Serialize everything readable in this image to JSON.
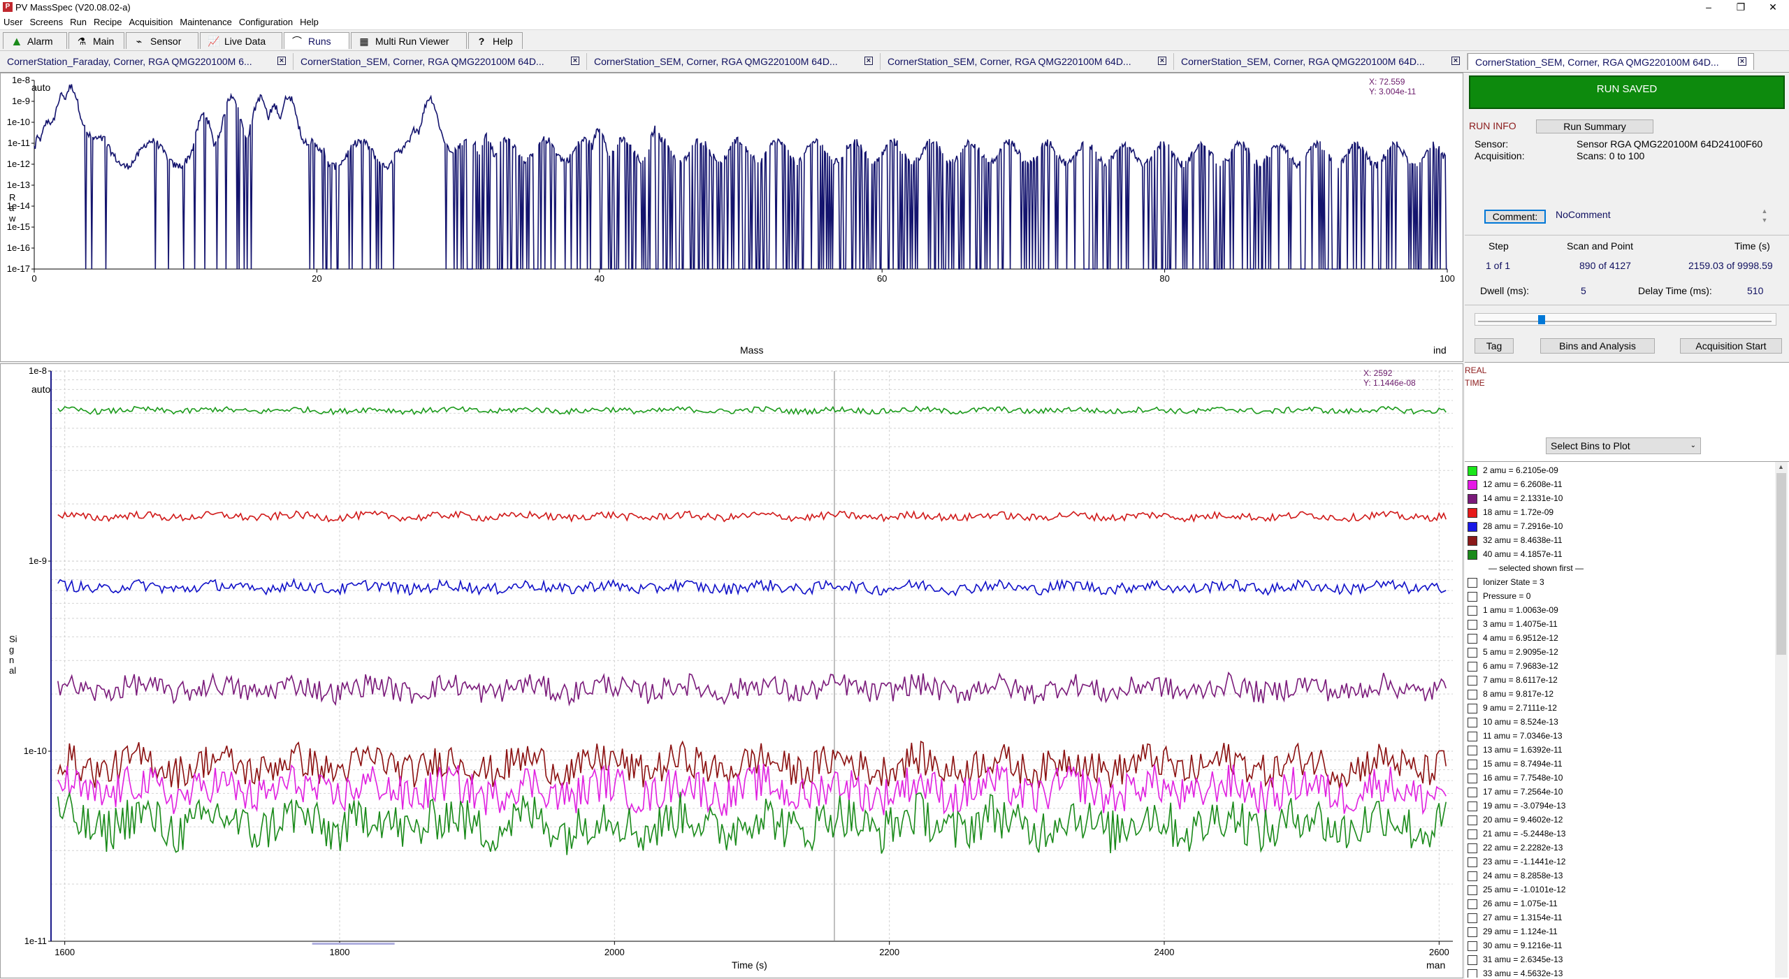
{
  "window": {
    "title": "PV MassSpec  (V20.08.02-a)",
    "controls": [
      "–",
      "❐",
      "✕"
    ]
  },
  "menu": [
    "User",
    "Screens",
    "Run",
    "Recipe",
    "Acquisition",
    "Maintenance",
    "Configuration",
    "Help"
  ],
  "toolbar": [
    {
      "label": "Alarm",
      "icon": "warning-triangle-icon"
    },
    {
      "label": "Main",
      "icon": "flask-icon"
    },
    {
      "label": "Sensor",
      "icon": "sensor-icon"
    },
    {
      "label": "Live Data",
      "icon": "chart-icon"
    },
    {
      "label": "Runs",
      "icon": "runs-icon"
    },
    {
      "label": "Multi Run Viewer",
      "icon": "multi-run-icon"
    },
    {
      "label": "Help",
      "icon": "question-icon"
    }
  ],
  "run_tabs": [
    "CornerStation_Faraday, Corner, RGA QMG220100M 6...",
    "CornerStation_SEM, Corner, RGA QMG220100M 64D...",
    "CornerStation_SEM, Corner, RGA QMG220100M 64D...",
    "CornerStation_SEM, Corner, RGA QMG220100M 64D...",
    "CornerStation_SEM, Corner, RGA QMG220100M 64D...",
    "CornerStation_SEM, Corner, RGA QMG220100M 64D..."
  ],
  "colors": {
    "trace_navy": "#14146e",
    "run_saved_green": "#0d8a0d",
    "label_red": "#8b1a1a",
    "cursor_text": "#6a1a6a"
  },
  "top_plot": {
    "scale_label": "auto",
    "cursor_x": "X: 72.559",
    "cursor_y": "Y: 3.004e-11",
    "ylabel": "Raw",
    "xlabel": "Mass",
    "x_unit": "ind",
    "y_ticks": [
      "1e-8",
      "1e-9",
      "1e-10",
      "1e-11",
      "1e-12",
      "1e-13",
      "1e-14",
      "1e-15",
      "1e-16",
      "1e-17"
    ],
    "x_ticks": [
      "0",
      "20",
      "40",
      "60",
      "80",
      "100"
    ]
  },
  "bottom_plot": {
    "scale_label": "auto",
    "cursor_x": "X: 2592",
    "cursor_y": "Y: 1.1446e-08",
    "ylabel": "Signal",
    "xlabel": "Time (s)",
    "x_unit": "man",
    "y_ticks": [
      "1e-8",
      "1e-9",
      "1e-10",
      "1e-11"
    ],
    "x_ticks": [
      "1600",
      "1800",
      "2000",
      "2200",
      "2400",
      "2600"
    ]
  },
  "chart_data": [
    {
      "type": "line",
      "xlabel": "Mass",
      "ylabel": "Raw",
      "xlim": [
        0,
        100
      ],
      "ylim": [
        1e-17,
        1e-08
      ],
      "yscale": "log",
      "cursor": {
        "x": 72.559,
        "y": 3.004e-11
      },
      "series": [
        {
          "peaks": [
            {
              "x": 1,
              "y": 1.2e-10
            },
            {
              "x": 2,
              "y": 2e-09
            },
            {
              "x": 2.6,
              "y": 5e-09
            },
            {
              "x": 12,
              "y": 2.5e-10
            },
            {
              "x": 14,
              "y": 2e-09
            },
            {
              "x": 16,
              "y": 1.5e-09
            },
            {
              "x": 17,
              "y": 6e-10
            },
            {
              "x": 18,
              "y": 1.8e-09
            },
            {
              "x": 27,
              "y": 5e-11
            },
            {
              "x": 28,
              "y": 1.5e-09
            },
            {
              "x": 32,
              "y": 2e-11
            },
            {
              "x": 40,
              "y": 5e-11
            },
            {
              "x": 44,
              "y": 5e-11
            }
          ]
        }
      ]
    },
    {
      "type": "line",
      "xlabel": "Time (s)",
      "ylabel": "Signal",
      "xlim": [
        1590,
        2610
      ],
      "ylim": [
        1e-11,
        1e-08
      ],
      "yscale": "log",
      "grid": true,
      "cursor": {
        "x": 2592,
        "y": 1.1446e-08,
        "line_x": 2160
      },
      "series": [
        {
          "name": "2 amu",
          "color": "#1a9a1a",
          "mean": 6.2105e-09
        },
        {
          "name": "18 amu",
          "color": "#d01818",
          "mean": 1.72e-09
        },
        {
          "name": "28 amu",
          "color": "#1010c8",
          "mean": 7.2916e-10
        },
        {
          "name": "14 amu",
          "color": "#7a1a7a",
          "mean": 2.1331e-10
        },
        {
          "name": "32 amu",
          "color": "#8b1010",
          "mean": 8.4638e-11
        },
        {
          "name": "12 amu",
          "color": "#e020e0",
          "mean": 6.2608e-11
        },
        {
          "name": "40 amu",
          "color": "#1a8a1a",
          "mean": 4.1857e-11
        }
      ]
    }
  ],
  "run_panel": {
    "status": "RUN  SAVED",
    "run_info_label": "RUN  INFO",
    "run_summary_button": "Run Summary",
    "sensor_label": "Sensor:",
    "sensor_value": "Sensor RGA QMG220100M 64D24100F60",
    "acquisition_label": "Acquisition:",
    "acquisition_value": "Scans: 0 to 100",
    "comment_button": "Comment:",
    "comment_value": "NoComment",
    "step_label": "Step",
    "step_value": "1 of 1",
    "scan_label": "Scan and Point",
    "scan_value": "890 of 4127",
    "time_label": "Time (s)",
    "time_value": "2159.03 of 9998.59",
    "dwell_label": "Dwell (ms):",
    "dwell_value": "5",
    "delay_label": "Delay Time (ms):",
    "delay_value": "510",
    "slider_fraction": 0.21,
    "tag_button": "Tag",
    "bins_button": "Bins and Analysis",
    "acq_start_button": "Acquisition Start",
    "realtime_label1": "REAL",
    "realtime_label2": "TIME",
    "select_bins": "Select Bins to Plot"
  },
  "legend_selected": [
    {
      "text": "2 amu = 6.2105e-09",
      "color": "#19e619"
    },
    {
      "text": "12 amu = 6.2608e-11",
      "color": "#e619e6"
    },
    {
      "text": "14 amu = 2.1331e-10",
      "color": "#7a1a7a"
    },
    {
      "text": "18 amu = 1.72e-09",
      "color": "#e61919"
    },
    {
      "text": "28 amu = 7.2916e-10",
      "color": "#1919e6"
    },
    {
      "text": "32 amu = 8.4638e-11",
      "color": "#8b1a1a"
    },
    {
      "text": "40 amu = 4.1857e-11",
      "color": "#1a8a1a"
    }
  ],
  "legend_separator": "— selected shown first —",
  "legend_unselected": [
    "Ionizer State = 3",
    "Pressure = 0",
    "1 amu = 1.0063e-09",
    "3 amu = 1.4075e-11",
    "4 amu = 6.9512e-12",
    "5 amu = 2.9095e-12",
    "6 amu = 7.9683e-12",
    "7 amu = 8.6117e-12",
    "8 amu = 9.817e-12",
    "9 amu = 2.7111e-12",
    "10 amu = 8.524e-13",
    "11 amu = 7.0346e-13",
    "13 amu = 1.6392e-11",
    "15 amu = 8.7494e-11",
    "16 amu = 7.7548e-10",
    "17 amu = 7.2564e-10",
    "19 amu = -3.0794e-13",
    "20 amu = 9.4602e-12",
    "21 amu = -5.2448e-13",
    "22 amu = 2.2282e-13",
    "23 amu = -1.1441e-12",
    "24 amu = 8.2858e-13",
    "25 amu = -1.0101e-12",
    "26 amu = 1.075e-11",
    "27 amu = 1.3154e-11",
    "29 amu = 1.124e-11",
    "30 amu = 9.1216e-11",
    "31 amu = 2.6345e-13",
    "33 amu = 4.5632e-13"
  ]
}
